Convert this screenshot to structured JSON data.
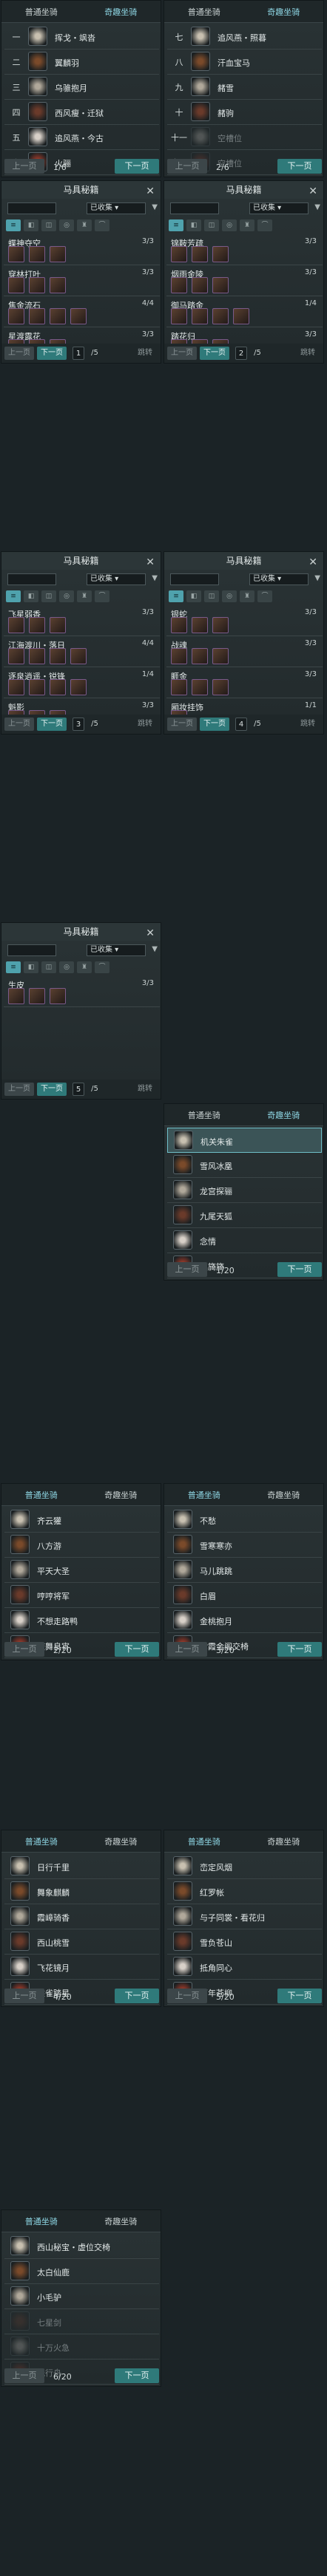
{
  "mount_panels": [
    {
      "tabs": [
        "普通坐骑",
        "奇趣坐骑"
      ],
      "active": 1,
      "rows": [
        [
          "一",
          "挥戈・飒沓"
        ],
        [
          "二",
          "翼麟羽"
        ],
        [
          "三",
          "乌骓抱月"
        ],
        [
          "四",
          "西风瘦・迁狱"
        ],
        [
          "五",
          "追风燕・今古"
        ],
        [
          "六",
          "火骊"
        ]
      ],
      "sel": -1,
      "locked": [],
      "page": "1/6",
      "prev": "上一页",
      "next": "下一页"
    },
    {
      "tabs": [
        "普通坐骑",
        "奇趣坐骑"
      ],
      "active": 1,
      "rows": [
        [
          "七",
          "追风燕・照暮"
        ],
        [
          "八",
          "汗血宝马"
        ],
        [
          "九",
          "赭雪"
        ],
        [
          "十",
          "赭驹"
        ],
        [
          "十一",
          "空槽位"
        ],
        [
          "十二",
          "空槽位"
        ]
      ],
      "sel": -1,
      "locked": [
        4,
        5
      ],
      "page": "2/6",
      "prev": "上一页",
      "next": "下一页"
    },
    {
      "tabs": [
        "普通坐骑",
        "奇趣坐骑"
      ],
      "active": 1,
      "rows": [
        [
          "",
          "机关朱雀"
        ],
        [
          "",
          "雪风冰凰"
        ],
        [
          "",
          "龙宫探骊"
        ],
        [
          "",
          "九尾天狐"
        ],
        [
          "",
          "念情"
        ],
        [
          "",
          "黑旖旖"
        ]
      ],
      "sel": 0,
      "locked": [],
      "page": "1/20",
      "prev": "上一页",
      "next": "下一页"
    },
    {
      "tabs": [
        "普通坐骑",
        "奇趣坐骑"
      ],
      "active": 0,
      "rows": [
        [
          "",
          "齐云獾"
        ],
        [
          "",
          "八方游"
        ],
        [
          "",
          "平天大圣"
        ],
        [
          "",
          "哼哼将军"
        ],
        [
          "",
          "不想走路鸭"
        ],
        [
          "",
          "庆舞良宵"
        ]
      ],
      "sel": -1,
      "locked": [],
      "page": "2/20",
      "prev": "上一页",
      "next": "下一页"
    },
    {
      "tabs": [
        "普通坐骑",
        "奇趣坐骑"
      ],
      "active": 0,
      "rows": [
        [
          "",
          "不愁"
        ],
        [
          "",
          "雪寒寒亦"
        ],
        [
          "",
          "马儿跳跳"
        ],
        [
          "",
          "白眉"
        ],
        [
          "",
          "金桃抱月"
        ],
        [
          "",
          "紫霞金阁交椅"
        ]
      ],
      "sel": -1,
      "locked": [],
      "page": "3/20",
      "prev": "上一页",
      "next": "下一页"
    },
    {
      "tabs": [
        "普通坐骑",
        "奇趣坐骑"
      ],
      "active": 0,
      "rows": [
        [
          "",
          "日行千里"
        ],
        [
          "",
          "舞象麒麟"
        ],
        [
          "",
          "霞嶂骑香"
        ],
        [
          "",
          "西山桃雪"
        ],
        [
          "",
          "飞花镜月"
        ],
        [
          "",
          "乘雀踏星"
        ]
      ],
      "sel": -1,
      "locked": [],
      "page": "4/20",
      "prev": "上一页",
      "next": "下一页"
    },
    {
      "tabs": [
        "普通坐骑",
        "奇趣坐骑"
      ],
      "active": 0,
      "rows": [
        [
          "",
          "峦定风烟"
        ],
        [
          "",
          "红罗帐"
        ],
        [
          "",
          "与子同裳・看花归"
        ],
        [
          "",
          "雪负苍山"
        ],
        [
          "",
          "抵角同心"
        ],
        [
          "",
          "百年苍柳"
        ]
      ],
      "sel": -1,
      "locked": [],
      "page": "5/20",
      "prev": "上一页",
      "next": "下一页"
    },
    {
      "tabs": [
        "普通坐骑",
        "奇趣坐骑"
      ],
      "active": 0,
      "rows": [
        [
          "",
          "西山秘宝・虚位交椅"
        ],
        [
          "",
          "太白仙鹿"
        ],
        [
          "",
          "小毛驴"
        ],
        [
          "",
          "七星剑"
        ],
        [
          "",
          "十万火急"
        ],
        [
          "",
          "纸行舟"
        ]
      ],
      "sel": -1,
      "locked": [
        3,
        4,
        5
      ],
      "page": "6/20",
      "prev": "上一页",
      "next": "下一页"
    }
  ],
  "equip_panels": [
    {
      "title": "马具秘籍",
      "select": "已收集",
      "sets": [
        [
          "蝶神夺空",
          "3/3",
          3
        ],
        [
          "穿林打叶",
          "3/3",
          3
        ],
        [
          "焦金流石",
          "4/4",
          4
        ],
        [
          "星渡露花",
          "3/3",
          3
        ]
      ],
      "page": "1",
      "total": "/5"
    },
    {
      "title": "马具秘籍",
      "select": "已收集",
      "sets": [
        [
          "锦鞍芳疏",
          "3/3",
          3
        ],
        [
          "烟雨金陵",
          "3/3",
          3
        ],
        [
          "御马踏金",
          "1/4",
          4
        ],
        [
          "踏花归",
          "3/3",
          3
        ]
      ],
      "page": "2",
      "total": "/5"
    },
    {
      "title": "马具秘籍",
      "select": "已收集",
      "sets": [
        [
          "飞星弱香",
          "3/3",
          3
        ],
        [
          "江海渡川・落日",
          "4/4",
          4
        ],
        [
          "逐泉逍遥・锐锋",
          "1/4",
          4
        ],
        [
          "魁影",
          "3/3",
          3
        ]
      ],
      "page": "3",
      "total": "/5"
    },
    {
      "title": "马具秘籍",
      "select": "已收集",
      "sets": [
        [
          "银蛇",
          "3/3",
          3
        ],
        [
          "战魂",
          "3/3",
          3
        ],
        [
          "睚金",
          "3/3",
          3
        ],
        [
          "厢妆挂饰",
          "1/1",
          1
        ]
      ],
      "page": "4",
      "total": "/5"
    },
    {
      "title": "马具秘籍",
      "select": "已收集",
      "sets": [
        [
          "生皮",
          "3/3",
          3
        ]
      ],
      "page": "5",
      "total": "/5"
    }
  ],
  "equip_buttons": {
    "prev": "上一页",
    "next": "下一页",
    "jump": "跳转"
  },
  "colors": {
    "accent": "#2f7a7a",
    "selected": "#6fbfc9",
    "bg": "#1b2326"
  }
}
